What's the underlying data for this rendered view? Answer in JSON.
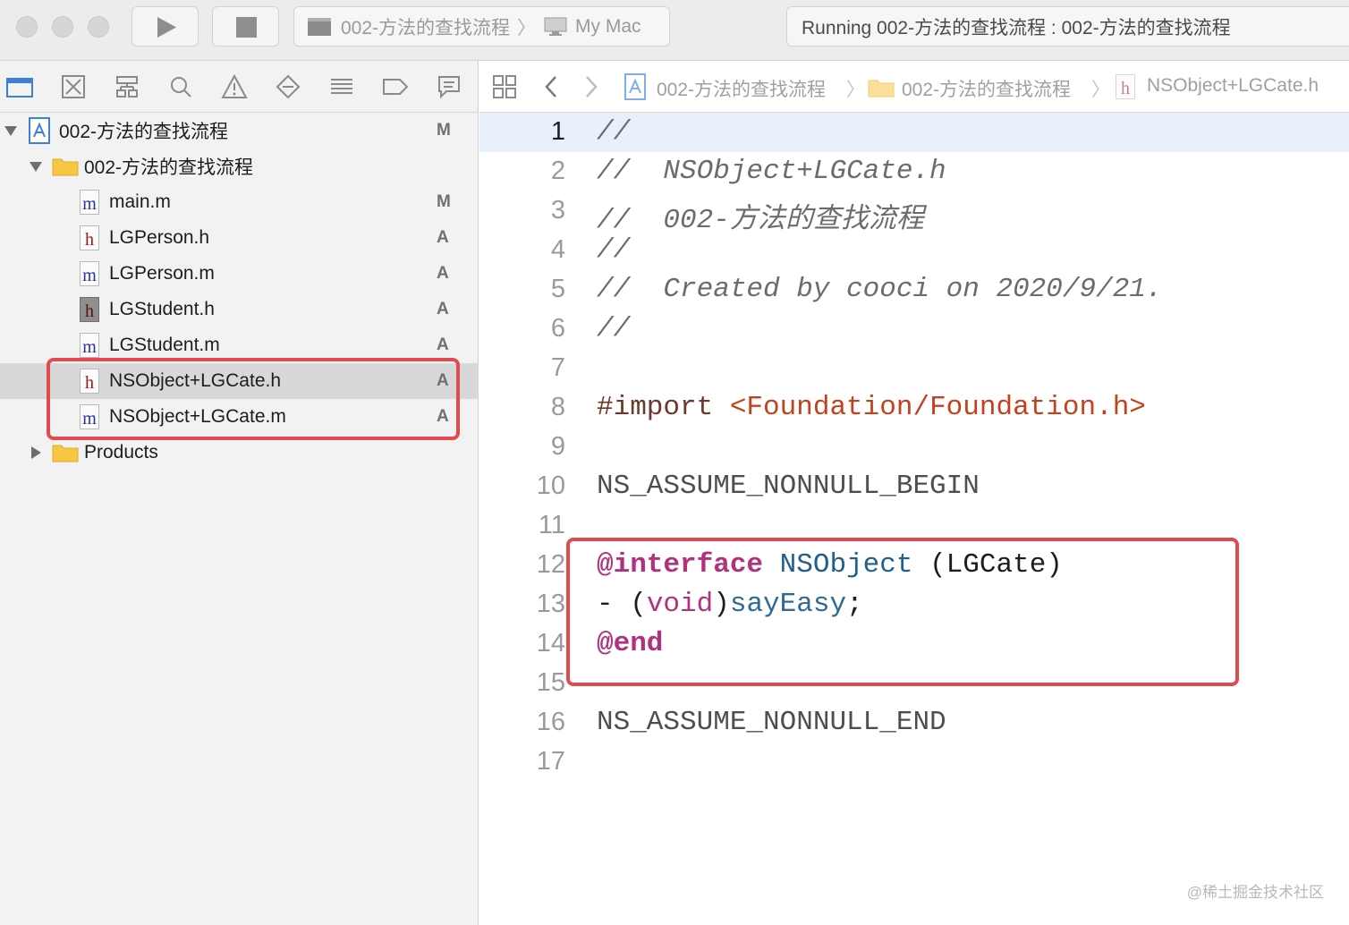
{
  "toolbar": {
    "scheme_target": "002-方法的查找流程",
    "scheme_device": "My Mac",
    "status_text": "Running 002-方法的查找流程 : 002-方法的查找流程"
  },
  "navigator": {
    "tree": [
      {
        "label": "002-方法的查找流程",
        "badge": "M",
        "kind": "project"
      },
      {
        "label": "002-方法的查找流程",
        "badge": "",
        "kind": "folder"
      },
      {
        "label": "main.m",
        "badge": "M",
        "kind": "m"
      },
      {
        "label": "LGPerson.h",
        "badge": "A",
        "kind": "h"
      },
      {
        "label": "LGPerson.m",
        "badge": "A",
        "kind": "m"
      },
      {
        "label": "LGStudent.h",
        "badge": "A",
        "kind": "h-dark"
      },
      {
        "label": "LGStudent.m",
        "badge": "A",
        "kind": "m"
      },
      {
        "label": "NSObject+LGCate.h",
        "badge": "A",
        "kind": "h"
      },
      {
        "label": "NSObject+LGCate.m",
        "badge": "A",
        "kind": "m"
      },
      {
        "label": "Products",
        "badge": "",
        "kind": "folder"
      }
    ],
    "icon_glyphs": {
      "m": "m",
      "h": "h"
    }
  },
  "jumpbar": {
    "crumbs": [
      "002-方法的查找流程",
      "002-方法的查找流程",
      "NSObject+LGCate.h"
    ]
  },
  "code": {
    "line_numbers": [
      "1",
      "2",
      "3",
      "4",
      "5",
      "6",
      "7",
      "8",
      "9",
      "10",
      "11",
      "12",
      "13",
      "14",
      "15",
      "16",
      "17"
    ],
    "comment_1": "//",
    "comment_2": "//  NSObject+LGCate.h",
    "comment_3": "//  002-方法的查找流程",
    "comment_4": "//",
    "comment_5": "//  Created by cooci on 2020/9/21.",
    "comment_6": "//",
    "import_kw": "#import ",
    "import_path": "<Foundation/Foundation.h>",
    "nonnull_begin": "NS_ASSUME_NONNULL_BEGIN",
    "interface_kw": "@interface",
    "interface_class": "NSObject",
    "interface_category": "(LGCate)",
    "method_dash": "- (",
    "method_return": "void",
    "method_close": ")",
    "method_name": "sayEasy",
    "method_semicolon": ";",
    "end_kw": "@end",
    "nonnull_end": "NS_ASSUME_NONNULL_END"
  },
  "watermark": "@稀土掘金技术社区"
}
